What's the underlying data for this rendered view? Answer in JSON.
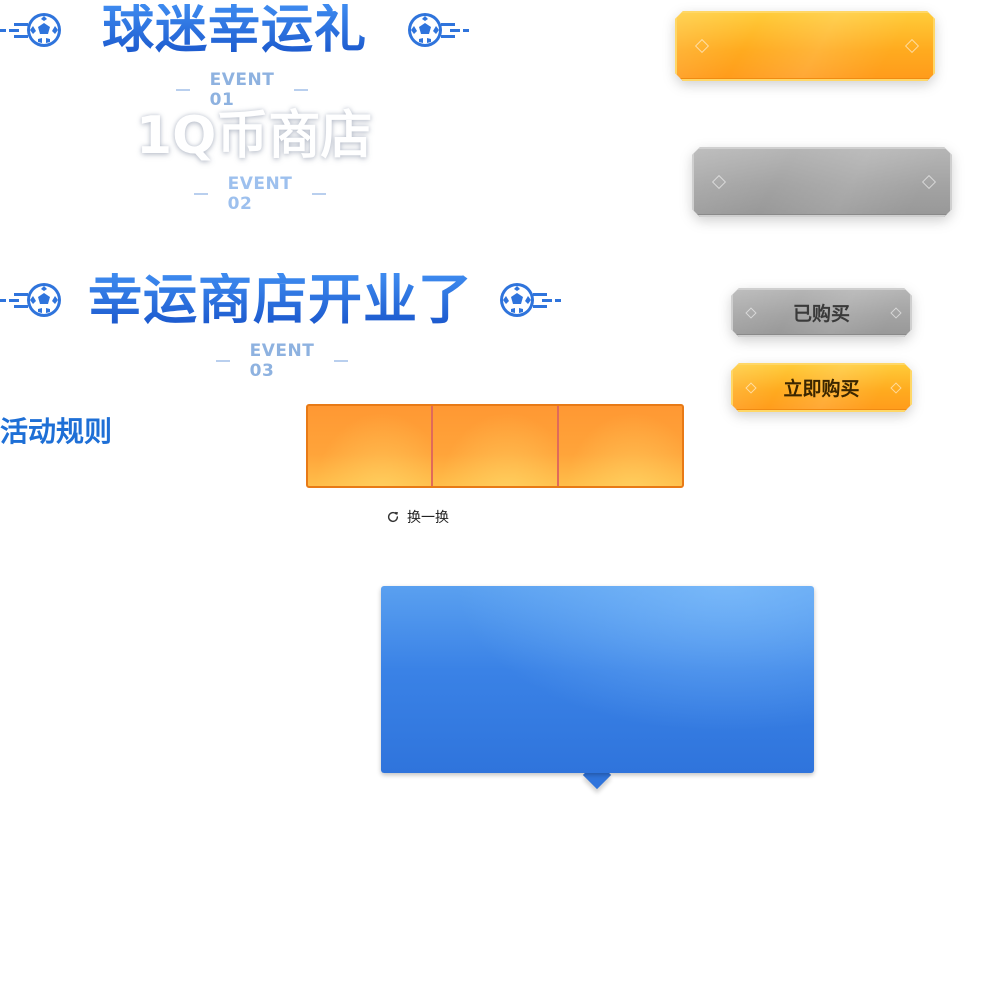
{
  "titles": {
    "event1": {
      "text": "球迷幸运礼",
      "event": "EVENT 01"
    },
    "event2": {
      "text": "1Q币商店",
      "event": "EVENT 02"
    },
    "event3": {
      "text": "幸运商店开业了",
      "event": "EVENT 03"
    }
  },
  "rules_heading": "活动规则",
  "buttons": {
    "purchased": "已购买",
    "buy_now": "立即购买"
  },
  "refresh": {
    "label": "换一换",
    "icon": "refresh-icon"
  },
  "icons": {
    "title_ornament": "soccer-ball-icon"
  },
  "colors": {
    "brand_blue": "#1f66d8",
    "event_text": "#8eb2e0",
    "orange": "#ffab1f",
    "gray": "#a3a3a3",
    "panel_blue": "#3a82e6",
    "tab_orange": "#ff9833"
  },
  "tabs": [
    {
      "id": "tab-1",
      "label": ""
    },
    {
      "id": "tab-2",
      "label": ""
    },
    {
      "id": "tab-3",
      "label": ""
    }
  ]
}
